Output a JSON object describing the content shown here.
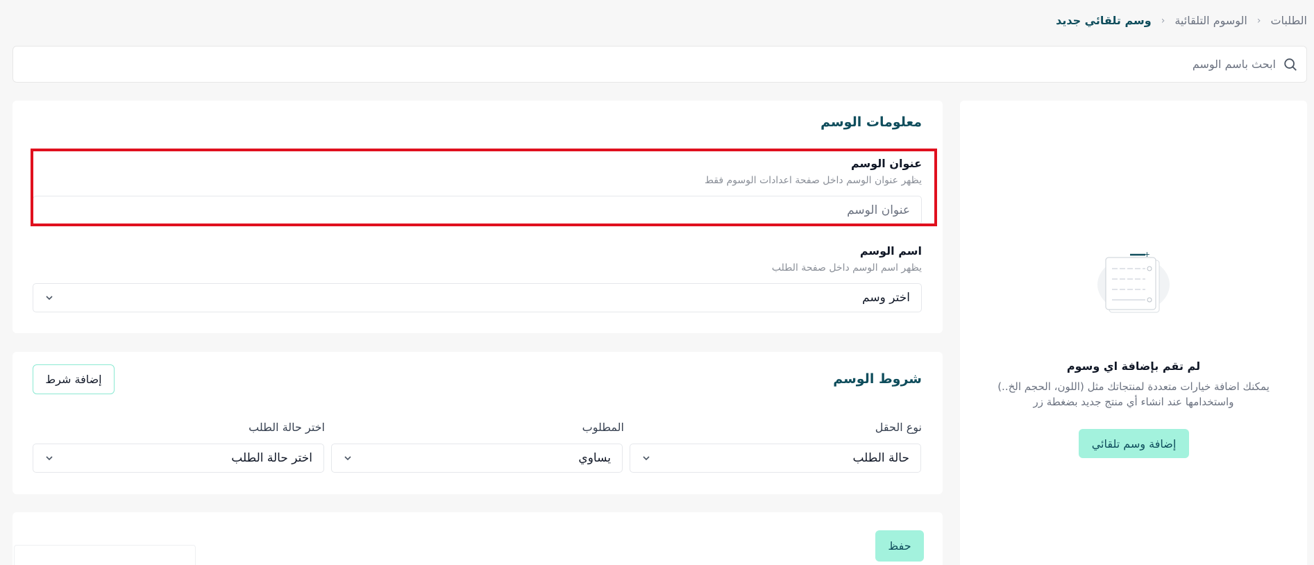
{
  "breadcrumb": {
    "items": [
      "الطلبات",
      "الوسوم التلقائية"
    ],
    "current": "وسم تلقائي جديد",
    "separator": "‹"
  },
  "search": {
    "placeholder": "ابحث باسم الوسم",
    "icon": "search-icon"
  },
  "tag_info": {
    "title": "معلومات الوسم",
    "tag_title": {
      "label": "عنوان الوسم",
      "hint": "يظهر عنوان الوسم داخل صفحة اعدادات الوسوم فقط",
      "placeholder": "عنوان الوسم",
      "value": ""
    },
    "tag_name": {
      "label": "اسم الوسم",
      "hint": "يظهر اسم الوسم داخل صفحة الطلب",
      "selected": "اختر وسم"
    }
  },
  "conditions": {
    "title": "شروط الوسم",
    "add_button": "إضافة شرط",
    "columns": {
      "field_type": "نوع الحقل",
      "required": "المطلوب",
      "order_status": "اختر حالة الطلب"
    },
    "row": {
      "field_type": "حالة الطلب",
      "operator": "يساوي",
      "status": "اختر حالة الطلب"
    }
  },
  "save_button": "حفظ",
  "empty_state": {
    "title": "لم تقم بإضافة اي وسوم",
    "description": "يمكنك اضافة خيارات متعددة لمنتجاتك مثل (اللون، الحجم الخ..) واستخدامها عند انشاء أي منتج جديد بضغطة زر",
    "button": "إضافة وسم تلقائي",
    "illustration": "empty-list-illustration"
  },
  "colors": {
    "accent": "#a3f2dd",
    "brand_text": "#0f4d5c",
    "highlight": "#e0101e",
    "page_bg": "#f7f7f7"
  }
}
